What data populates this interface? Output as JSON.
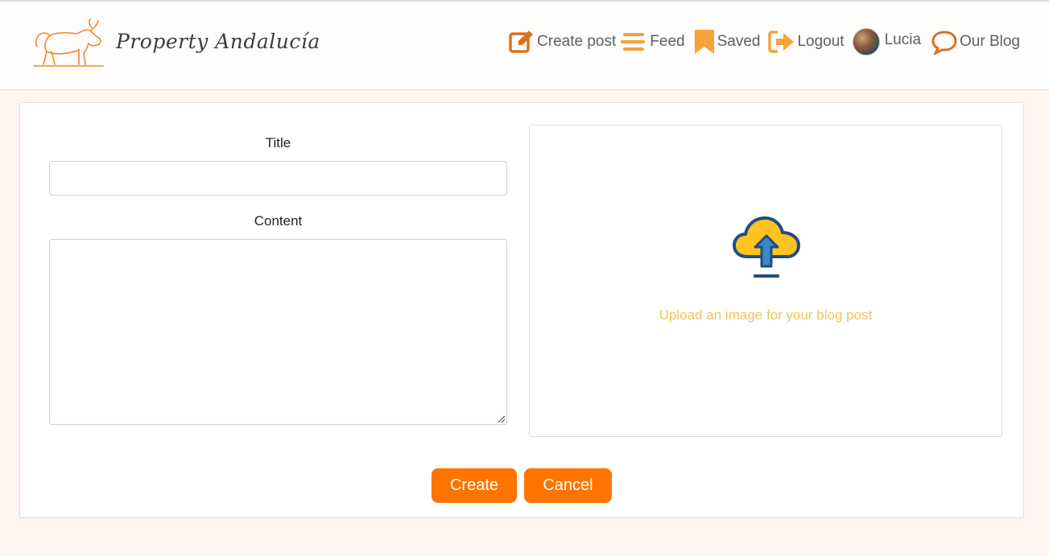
{
  "header": {
    "brand_name": "Property Andalucía",
    "nav": {
      "create_post": "Create post",
      "feed": "Feed",
      "saved": "Saved",
      "logout": "Logout",
      "user": "Lucia",
      "our_blog": "Our Blog"
    },
    "icons": {
      "logo": "bull-logo",
      "create_post": "edit-icon",
      "feed": "menu-bars-icon",
      "saved": "bookmark-icon",
      "logout": "logout-icon",
      "user": "avatar",
      "our_blog": "speech-bubble-icon"
    }
  },
  "form": {
    "title_label": "Title",
    "title_value": "",
    "content_label": "Content",
    "content_value": "",
    "upload_text": "Upload an image for your blog post",
    "upload_icon": "cloud-upload-icon",
    "create_button": "Create",
    "cancel_button": "Cancel"
  },
  "colors": {
    "accent": "#ff7300",
    "icon_orange": "#f7a23a",
    "icon_dark_orange": "#d9721e",
    "upload_text": "#f2c35c",
    "page_background": "#fff4f0"
  }
}
